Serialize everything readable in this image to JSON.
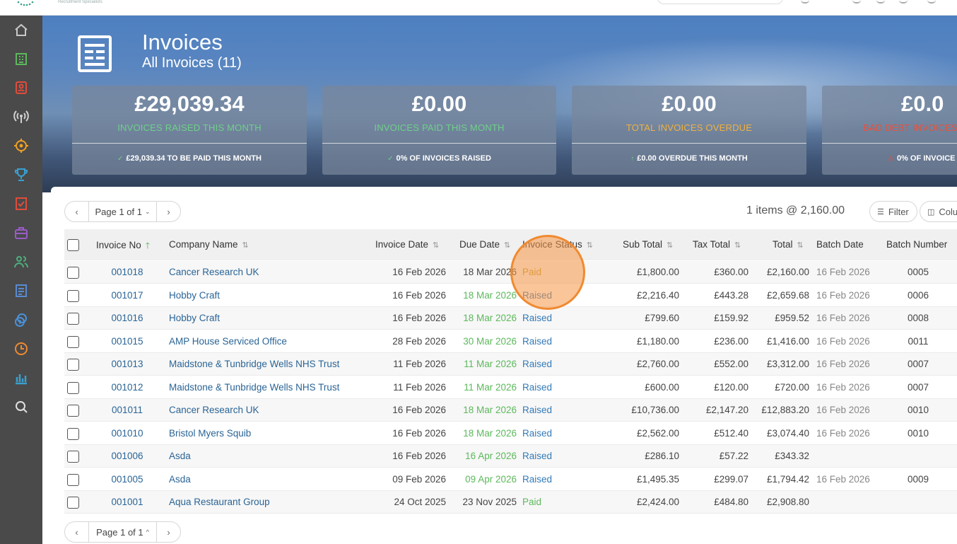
{
  "page": {
    "title": "Invoices",
    "subtitle": "All Invoices (11)"
  },
  "topbar": {
    "brand_tagline": "Recruitment Specialists"
  },
  "sidebar": {
    "items": [
      {
        "name": "home",
        "icon": "home-icon",
        "color": "#c8c8c8"
      },
      {
        "name": "companies",
        "icon": "building-icon",
        "color": "#5cb85c"
      },
      {
        "name": "contacts",
        "icon": "contact-card-icon",
        "color": "#e04c3c"
      },
      {
        "name": "broadcast",
        "icon": "broadcast-icon",
        "color": "#d0d0d0"
      },
      {
        "name": "targets",
        "icon": "crosshair-icon",
        "color": "#f0a020"
      },
      {
        "name": "awards",
        "icon": "trophy-icon",
        "color": "#3aa0d0"
      },
      {
        "name": "tasks",
        "icon": "checklist-icon",
        "color": "#e04c3c"
      },
      {
        "name": "jobs",
        "icon": "briefcase-icon",
        "color": "#9a5cc8"
      },
      {
        "name": "candidates",
        "icon": "people-icon",
        "color": "#4cb07c"
      },
      {
        "name": "invoices",
        "icon": "document-icon",
        "color": "#5a8ad0"
      },
      {
        "name": "finance",
        "icon": "coins-icon",
        "color": "#4a90d8"
      },
      {
        "name": "timesheets",
        "icon": "clock-icon",
        "color": "#f08a30"
      },
      {
        "name": "reports",
        "icon": "bar-chart-icon",
        "color": "#3aa0d0"
      },
      {
        "name": "search",
        "icon": "search-icon",
        "color": "#e0e0e0"
      }
    ]
  },
  "cards": [
    {
      "value": "£29,039.34",
      "label": "INVOICES RAISED THIS MONTH",
      "label_color": "#6fd08a",
      "footer": "£29,039.34 TO BE PAID THIS MONTH",
      "footer_icon": "✓",
      "footer_icon_color": "#6fd08a"
    },
    {
      "value": "£0.00",
      "label": "INVOICES PAID THIS MONTH",
      "label_color": "#6fd08a",
      "footer": "0% OF INVOICES RAISED",
      "footer_icon": "✓",
      "footer_icon_color": "#6fd08a"
    },
    {
      "value": "£0.00",
      "label": "TOTAL INVOICES OVERDUE",
      "label_color": "#f0b040",
      "footer": "£0.00 OVERDUE THIS MONTH",
      "footer_icon": "↑",
      "footer_icon_color": "#6fd08a"
    },
    {
      "value": "£0.0",
      "label": "BAD DEBT INVOICES",
      "label_color": "#e8503c",
      "footer": "0% OF INVOICE",
      "footer_icon": "⚠",
      "footer_icon_color": "#e8503c"
    }
  ],
  "pager": {
    "page_label": "Page 1 of 1",
    "prev": "‹",
    "next": "›",
    "chev_top": "⌄",
    "chev_bottom": "^"
  },
  "toolbar": {
    "summary": "1 items @ 2,160.00",
    "filter_label": "Filter",
    "columns_label": "Colu"
  },
  "table": {
    "headers": {
      "invoice_no": "Invoice No",
      "company_name": "Company Name",
      "invoice_date": "Invoice Date",
      "due_date": "Due Date",
      "invoice_status": "Invoice Status",
      "sub_total": "Sub Total",
      "tax_total": "Tax Total",
      "total": "Total",
      "batch_date": "Batch Date",
      "batch_number": "Batch Number"
    },
    "rows": [
      {
        "invoice_no": "001018",
        "company": "Cancer Research UK",
        "invoice_date": "16 Feb 2026",
        "due_date": "18 Mar 2026",
        "due_overdue": false,
        "status": "Paid",
        "sub_total": "£1,800.00",
        "tax_total": "£360.00",
        "total": "£2,160.00",
        "batch_date": "16 Feb 2026",
        "batch_number": "0005"
      },
      {
        "invoice_no": "001017",
        "company": "Hobby Craft",
        "invoice_date": "16 Feb 2026",
        "due_date": "18 Mar 2026",
        "due_overdue": true,
        "status": "Raised",
        "sub_total": "£2,216.40",
        "tax_total": "£443.28",
        "total": "£2,659.68",
        "batch_date": "16 Feb 2026",
        "batch_number": "0006"
      },
      {
        "invoice_no": "001016",
        "company": "Hobby Craft",
        "invoice_date": "16 Feb 2026",
        "due_date": "18 Mar 2026",
        "due_overdue": true,
        "status": "Raised",
        "sub_total": "£799.60",
        "tax_total": "£159.92",
        "total": "£959.52",
        "batch_date": "16 Feb 2026",
        "batch_number": "0008"
      },
      {
        "invoice_no": "001015",
        "company": "AMP House Serviced Office",
        "invoice_date": "28 Feb 2026",
        "due_date": "30 Mar 2026",
        "due_overdue": true,
        "status": "Raised",
        "sub_total": "£1,180.00",
        "tax_total": "£236.00",
        "total": "£1,416.00",
        "batch_date": "16 Feb 2026",
        "batch_number": "0011"
      },
      {
        "invoice_no": "001013",
        "company": "Maidstone & Tunbridge Wells NHS Trust",
        "invoice_date": "11 Feb 2026",
        "due_date": "11 Mar 2026",
        "due_overdue": true,
        "status": "Raised",
        "sub_total": "£2,760.00",
        "tax_total": "£552.00",
        "total": "£3,312.00",
        "batch_date": "16 Feb 2026",
        "batch_number": "0007"
      },
      {
        "invoice_no": "001012",
        "company": "Maidstone & Tunbridge Wells NHS Trust",
        "invoice_date": "11 Feb 2026",
        "due_date": "11 Mar 2026",
        "due_overdue": true,
        "status": "Raised",
        "sub_total": "£600.00",
        "tax_total": "£120.00",
        "total": "£720.00",
        "batch_date": "16 Feb 2026",
        "batch_number": "0007"
      },
      {
        "invoice_no": "001011",
        "company": "Cancer Research UK",
        "invoice_date": "16 Feb 2026",
        "due_date": "18 Mar 2026",
        "due_overdue": true,
        "status": "Raised",
        "sub_total": "£10,736.00",
        "tax_total": "£2,147.20",
        "total": "£12,883.20",
        "batch_date": "16 Feb 2026",
        "batch_number": "0010"
      },
      {
        "invoice_no": "001010",
        "company": "Bristol Myers Squib",
        "invoice_date": "16 Feb 2026",
        "due_date": "18 Mar 2026",
        "due_overdue": true,
        "status": "Raised",
        "sub_total": "£2,562.00",
        "tax_total": "£512.40",
        "total": "£3,074.40",
        "batch_date": "16 Feb 2026",
        "batch_number": "0010"
      },
      {
        "invoice_no": "001006",
        "company": "Asda",
        "invoice_date": "16 Feb 2026",
        "due_date": "16 Apr 2026",
        "due_overdue": true,
        "status": "Raised",
        "sub_total": "£286.10",
        "tax_total": "£57.22",
        "total": "£343.32",
        "batch_date": "",
        "batch_number": ""
      },
      {
        "invoice_no": "001005",
        "company": "Asda",
        "invoice_date": "09 Feb 2026",
        "due_date": "09 Apr 2026",
        "due_overdue": true,
        "status": "Raised",
        "sub_total": "£1,495.35",
        "tax_total": "£299.07",
        "total": "£1,794.42",
        "batch_date": "16 Feb 2026",
        "batch_number": "0009"
      },
      {
        "invoice_no": "001001",
        "company": "Aqua Restaurant Group",
        "invoice_date": "24 Oct 2025",
        "due_date": "23 Nov 2025",
        "due_overdue": false,
        "status": "Paid",
        "sub_total": "£2,424.00",
        "tax_total": "£484.80",
        "total": "£2,908.80",
        "batch_date": "",
        "batch_number": ""
      }
    ]
  }
}
